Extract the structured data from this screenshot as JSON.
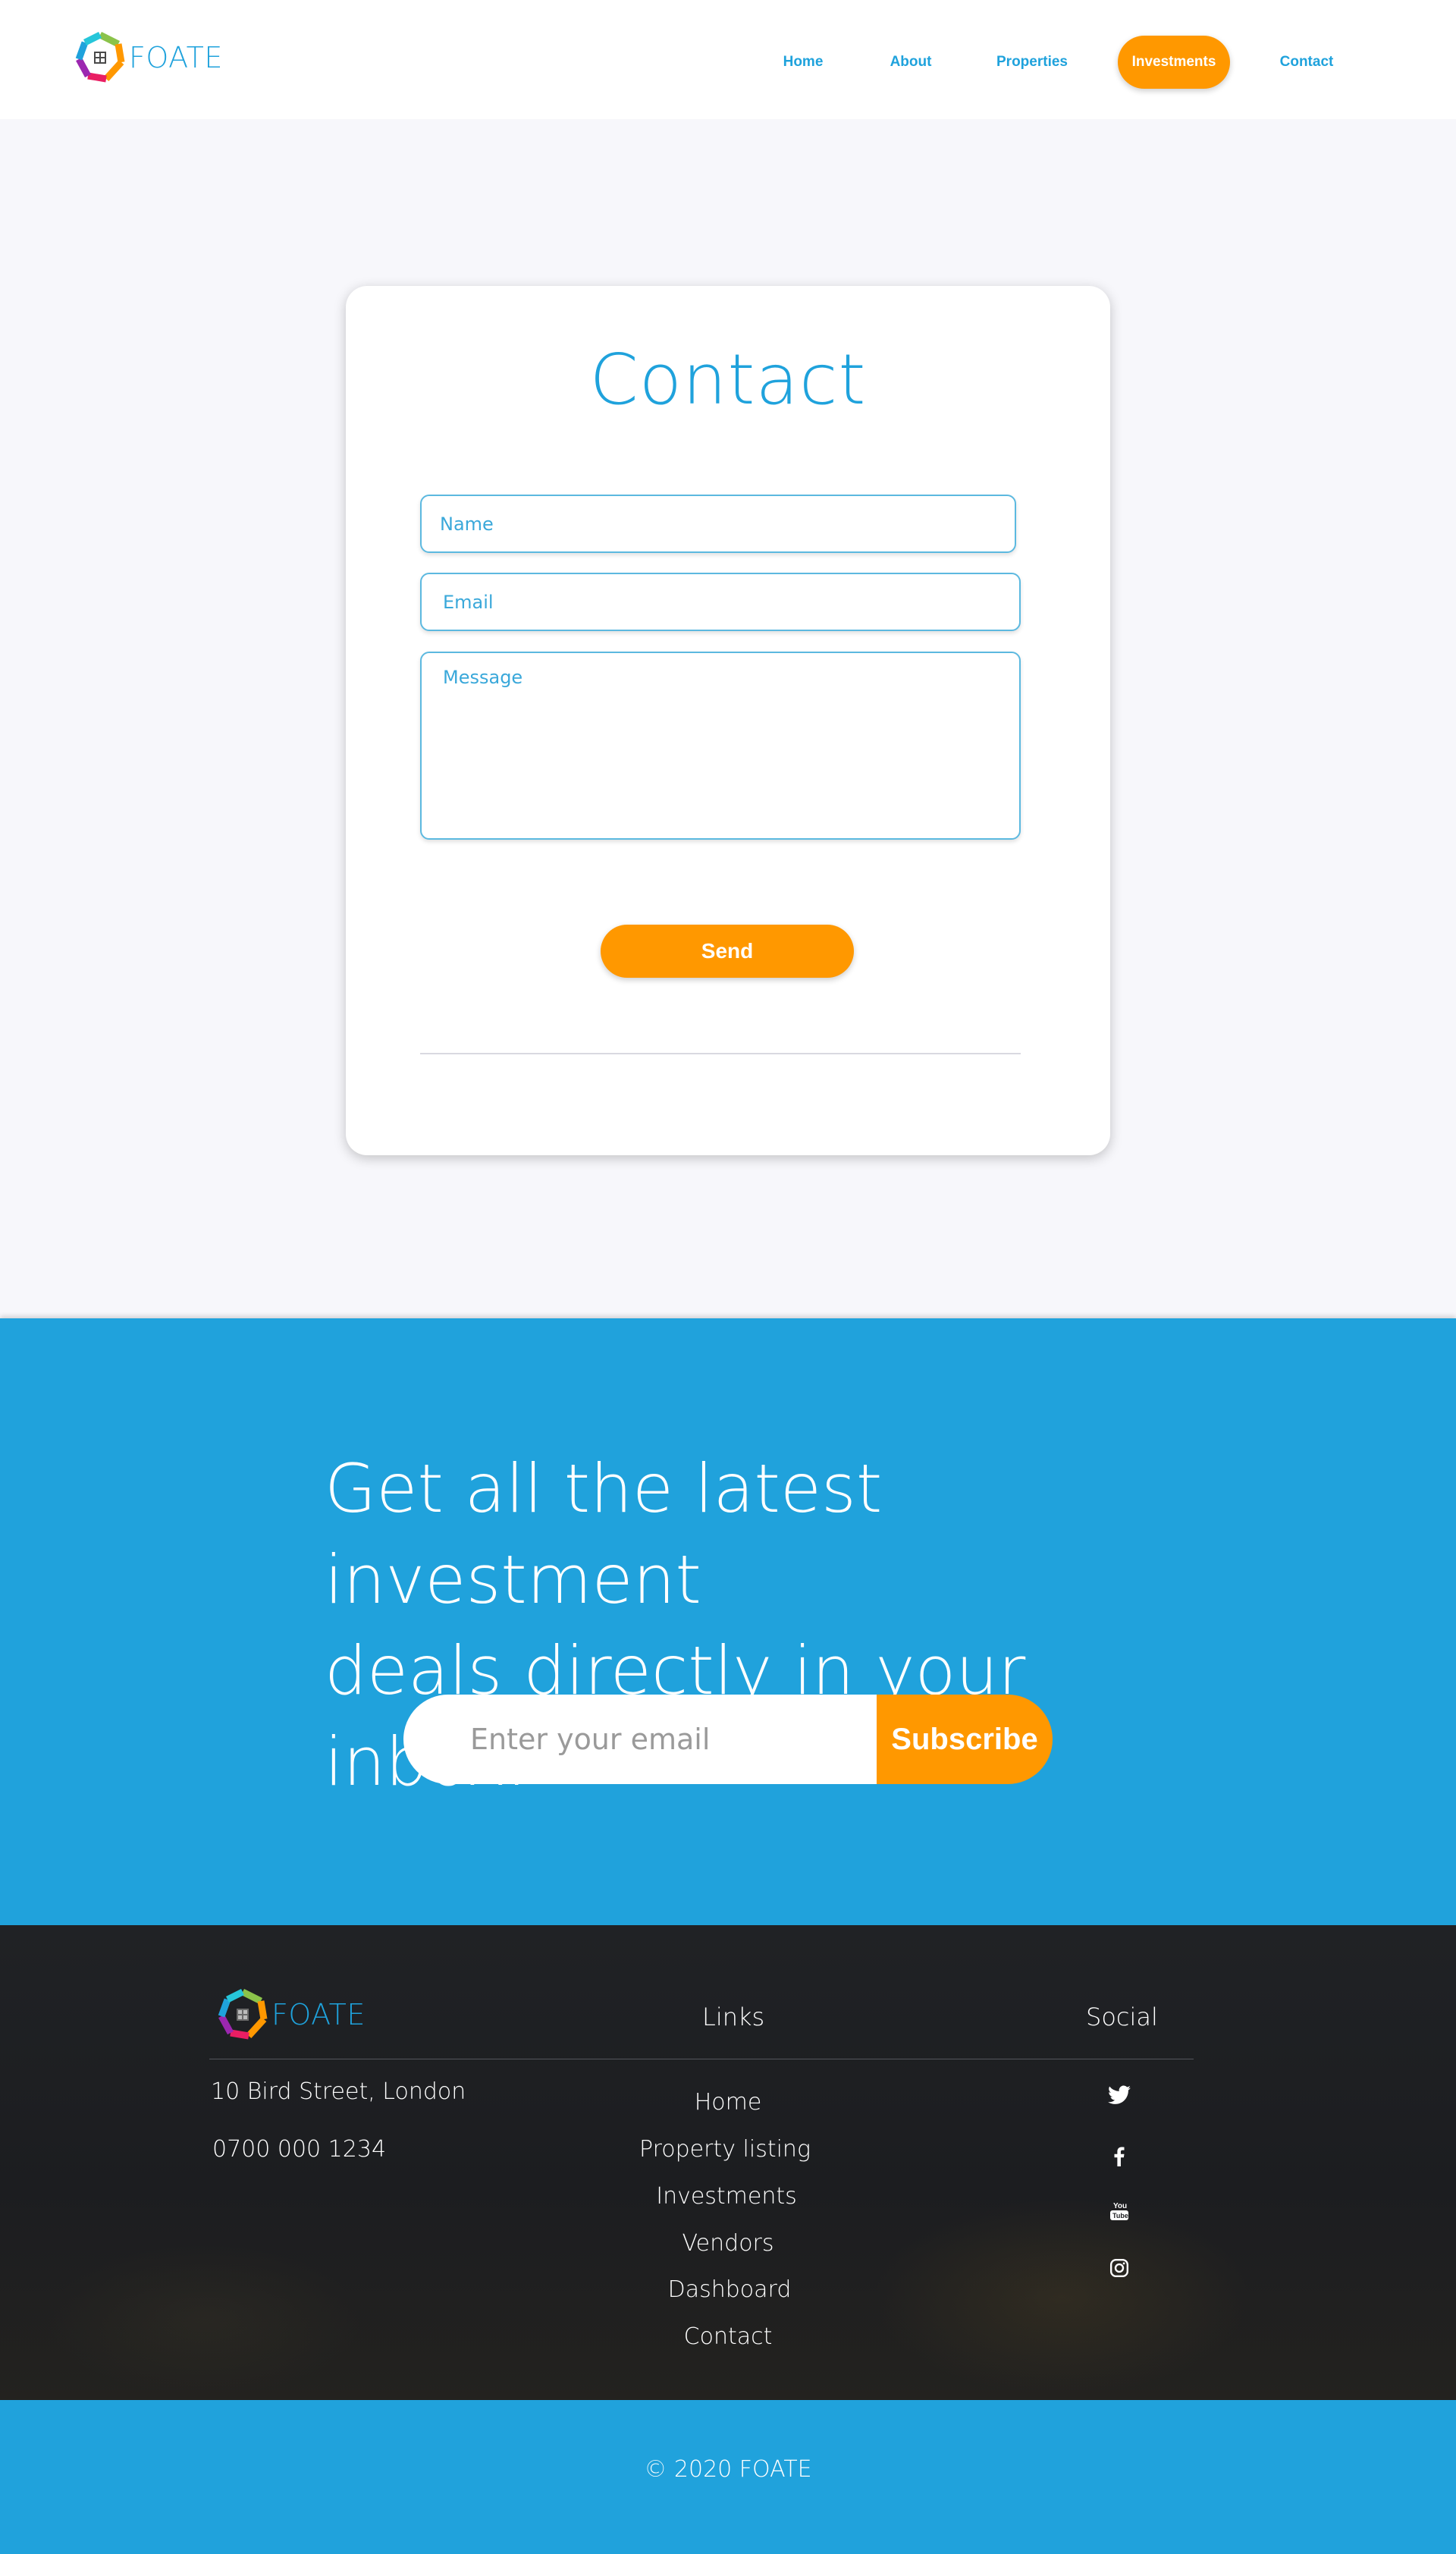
{
  "brand": {
    "name": "FOATE"
  },
  "nav": {
    "items": [
      {
        "label": "Home"
      },
      {
        "label": "About"
      },
      {
        "label": "Properties"
      },
      {
        "label": "Investments",
        "active": true
      },
      {
        "label": "Contact"
      }
    ]
  },
  "contact": {
    "title": "Contact",
    "name_placeholder": "Name",
    "email_placeholder": "Email",
    "message_placeholder": "Message",
    "send_label": "Send"
  },
  "newsletter": {
    "heading_line1": "Get all the latest investment",
    "heading_line2": "deals directly in your inbox.",
    "email_placeholder": "Enter your email",
    "subscribe_label": "Subscribe"
  },
  "footer": {
    "address": "10 Bird Street, London",
    "phone": "0700 000 1234",
    "links_title": "Links",
    "links": [
      "Home",
      "Property listing",
      "Investments",
      "Vendors",
      "Dashboard",
      "Contact"
    ],
    "social_title": "Social",
    "social_icons": [
      "twitter-icon",
      "facebook-icon",
      "youtube-icon",
      "instagram-icon"
    ]
  },
  "copyright": "© 2020 FOATE",
  "colors": {
    "primary_blue": "#20a2dc",
    "accent_orange": "#ff9800",
    "footer_dark": "#1e1f22",
    "page_bg": "#f7f7fb"
  }
}
